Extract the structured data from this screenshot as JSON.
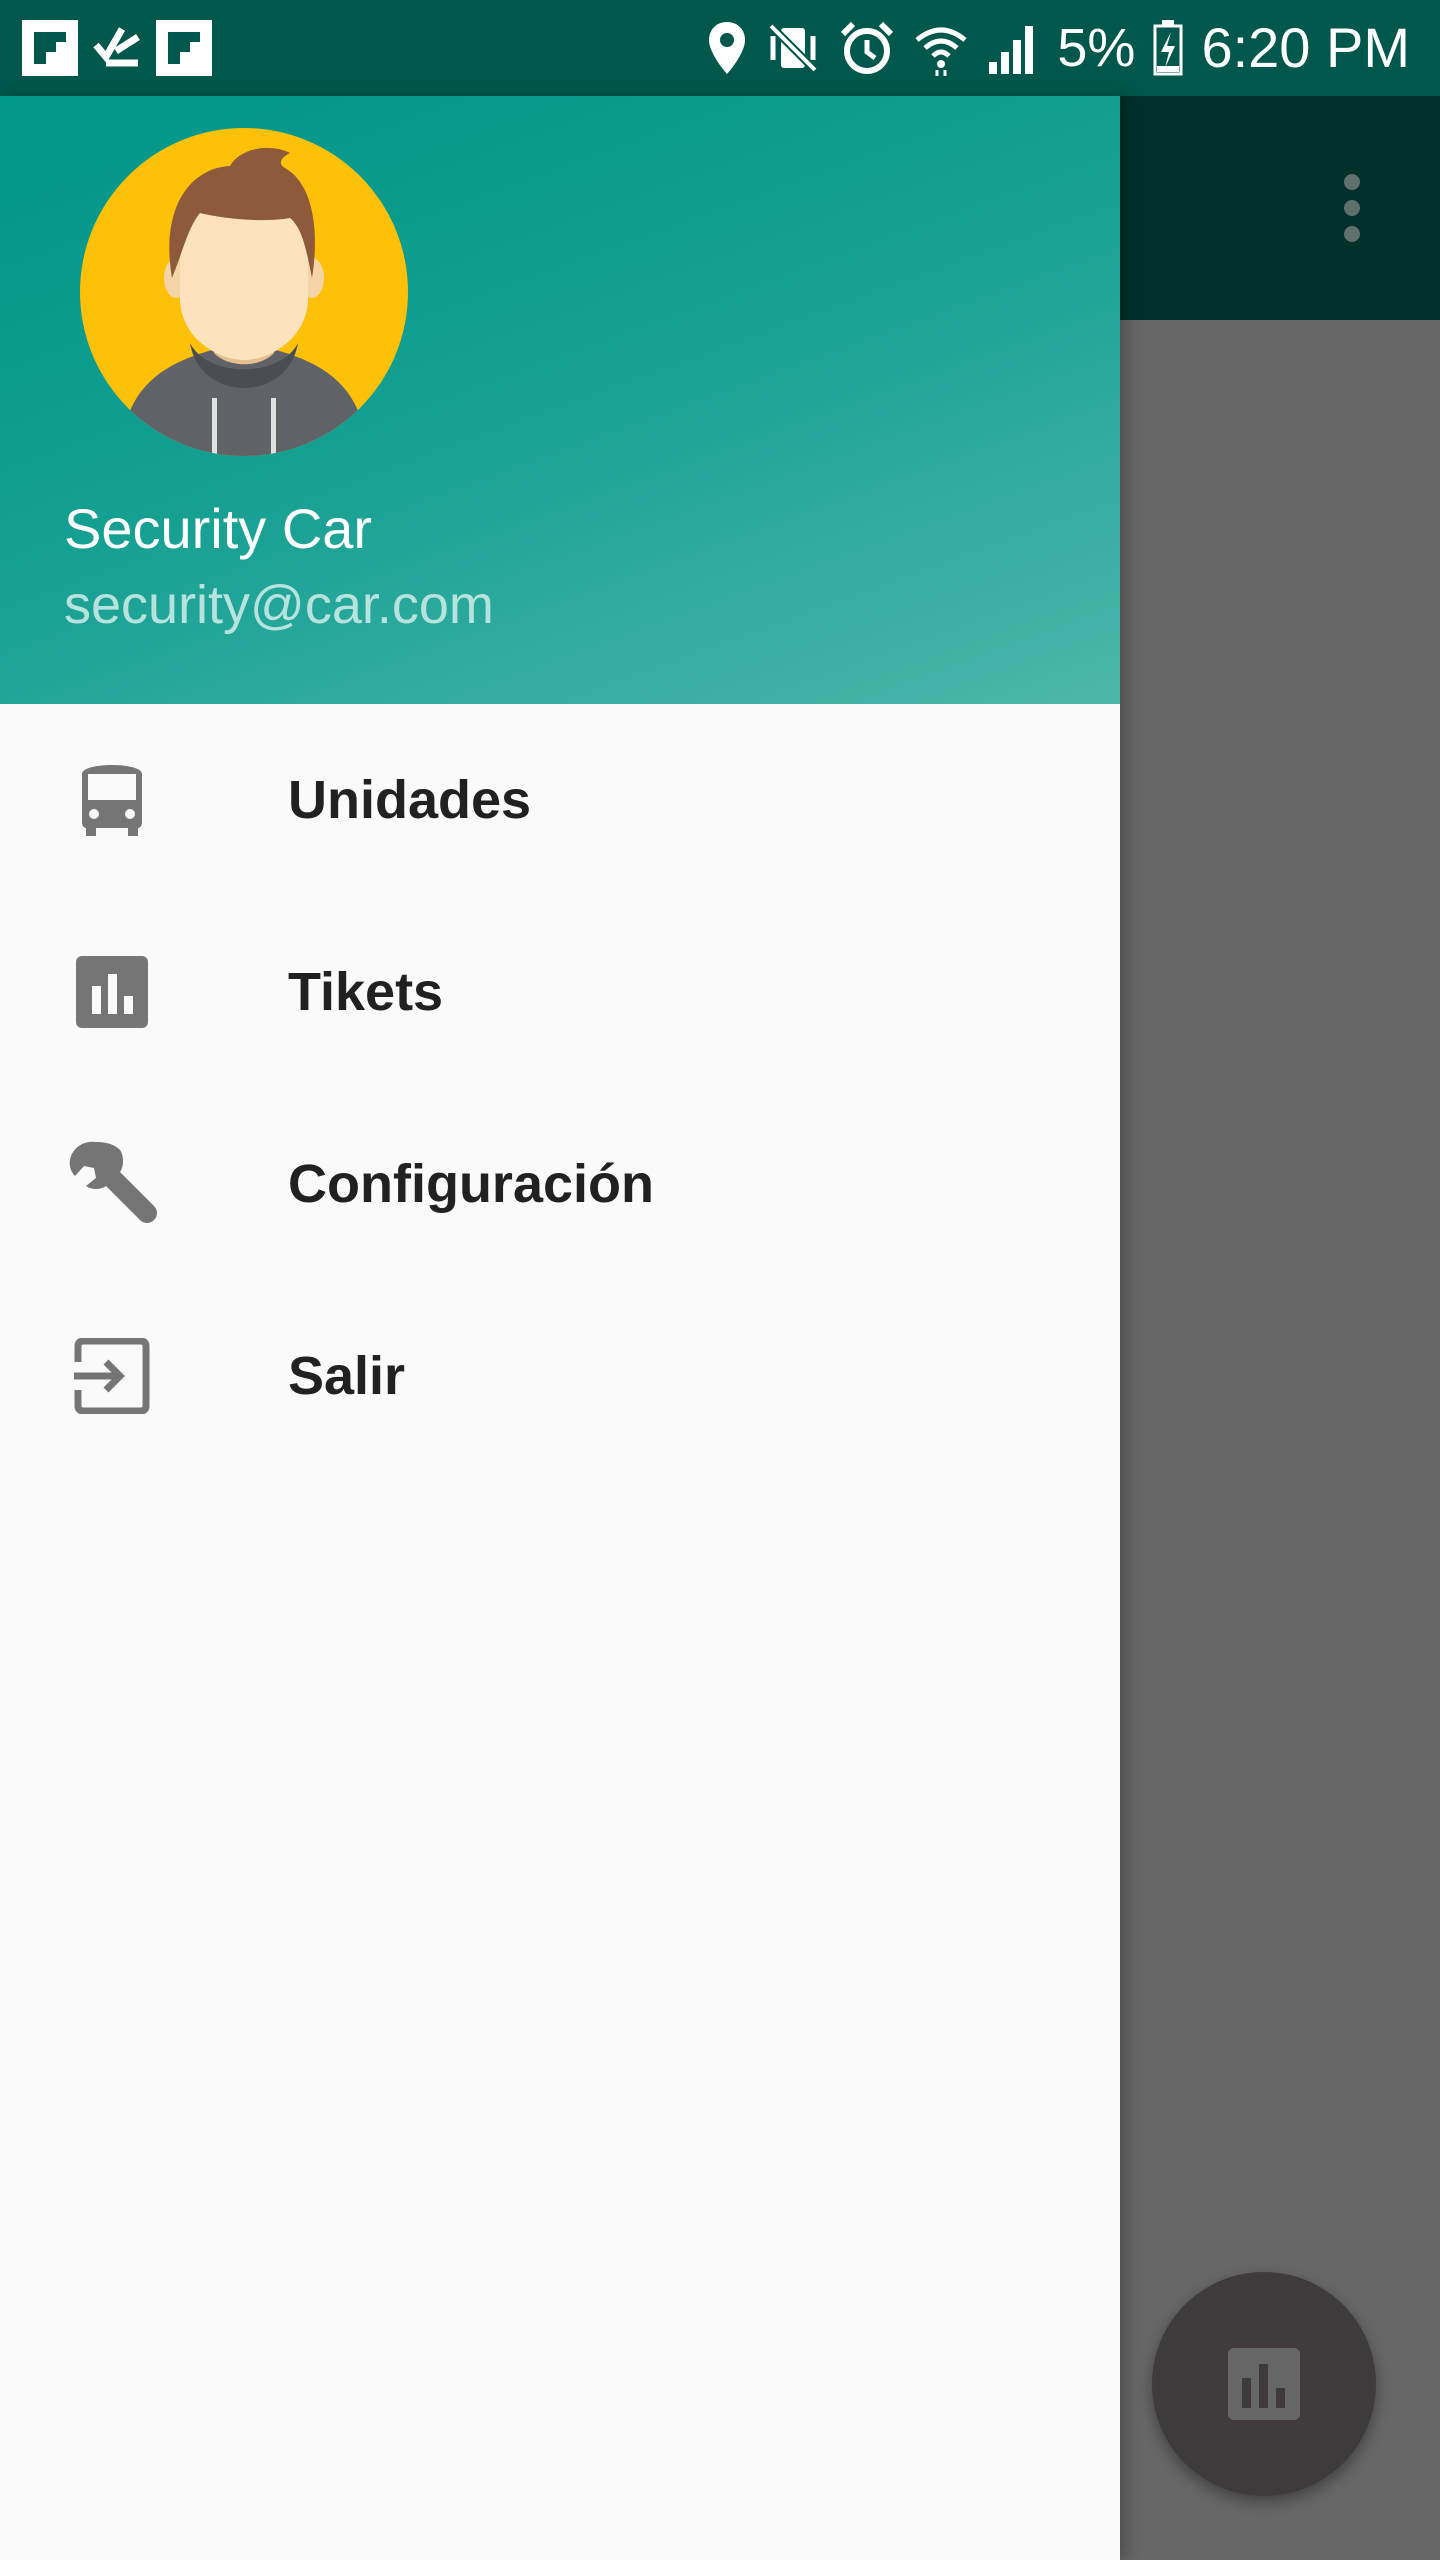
{
  "status_bar": {
    "battery": "5%",
    "time": "6:20 PM",
    "icons": [
      "flipboard-icon",
      "task-check-icon",
      "flipboard-icon",
      "location-icon",
      "vibrate-mute-icon",
      "alarm-icon",
      "wifi-icon",
      "signal-icon",
      "battery-charging-icon"
    ]
  },
  "drawer": {
    "header": {
      "name": "Security Car",
      "email": "security@car.com",
      "avatar": "user-avatar"
    },
    "items": [
      {
        "label": "Unidades",
        "icon": "bus-icon"
      },
      {
        "label": "Tikets",
        "icon": "bar-chart-icon"
      },
      {
        "label": "Configuración",
        "icon": "wrench-icon"
      },
      {
        "label": "Salir",
        "icon": "exit-icon"
      }
    ]
  },
  "app": {
    "toolbar_menu_icon": "more-vert-icon",
    "fab_icon": "bar-chart-icon"
  },
  "colors": {
    "status_bar": "#00574B",
    "header_start": "#009688",
    "header_end": "#4DB6AC",
    "icon_grey": "#757575",
    "scrim": "#666666"
  }
}
